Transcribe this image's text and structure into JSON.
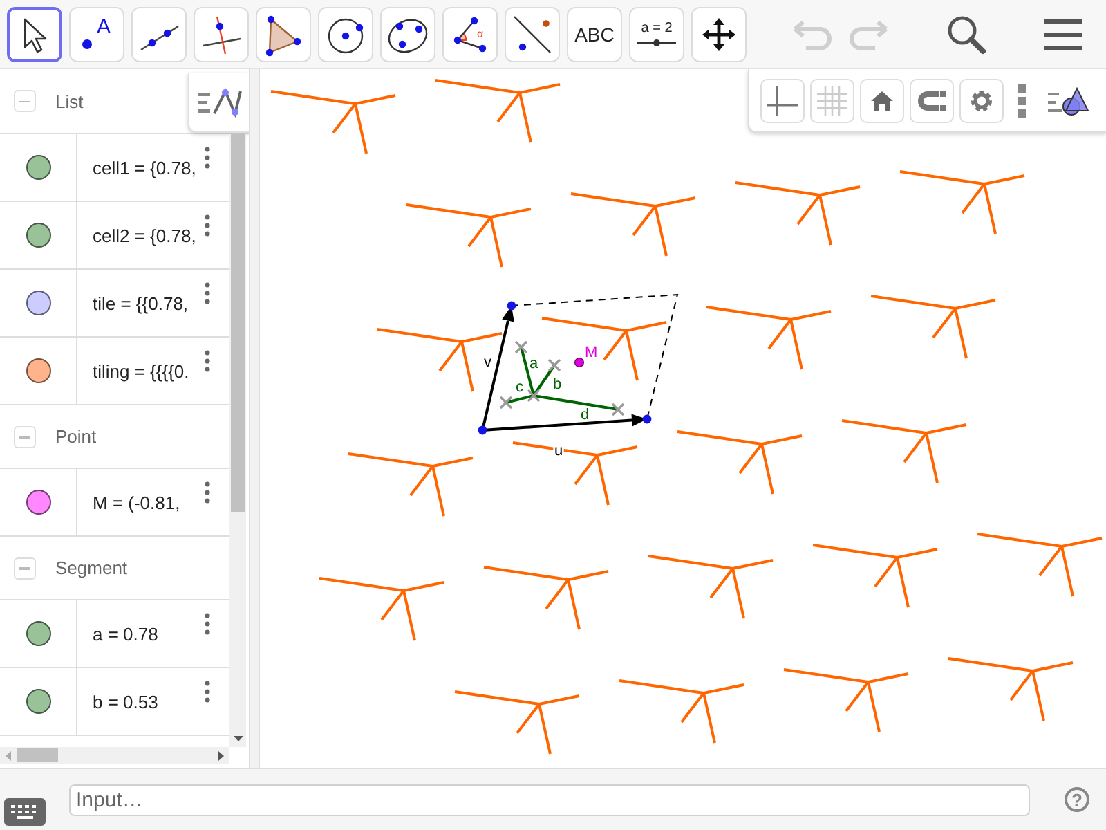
{
  "toolbar": {
    "tools": [
      {
        "kind": "move",
        "selected": true
      },
      {
        "kind": "point",
        "label": "A",
        "selected": false
      },
      {
        "kind": "line",
        "selected": false
      },
      {
        "kind": "perpendicular",
        "selected": false
      },
      {
        "kind": "polygon",
        "selected": false
      },
      {
        "kind": "circle",
        "selected": false
      },
      {
        "kind": "conic",
        "selected": false
      },
      {
        "kind": "angle",
        "label": "α",
        "selected": false
      },
      {
        "kind": "reflect",
        "selected": false
      },
      {
        "kind": "text",
        "label": "ABC",
        "selected": false
      },
      {
        "kind": "slider",
        "label": "a = 2",
        "selected": false
      },
      {
        "kind": "move-view",
        "selected": false
      }
    ],
    "undo": {
      "disabled": true
    },
    "redo": {
      "disabled": true
    }
  },
  "algebra": {
    "groups": [
      {
        "title": "List",
        "expanded": true,
        "items": [
          {
            "text": "cell1 = {0.78,",
            "color": "#99c299"
          },
          {
            "text": "cell2 = {0.78,",
            "color": "#99c299"
          },
          {
            "text": "tile = {{0.78,",
            "color": "#ccccff"
          },
          {
            "text": "tiling = {{{{0.",
            "color": "#ffb38a"
          }
        ]
      },
      {
        "title": "Point",
        "expanded": true,
        "items": [
          {
            "text": "M = (-0.81,",
            "color": "#ff88ff"
          }
        ]
      },
      {
        "title": "Segment",
        "expanded": true,
        "items": [
          {
            "text": "a = 0.78",
            "color": "#99c299"
          },
          {
            "text": "b = 0.53",
            "color": "#99c299"
          }
        ]
      }
    ]
  },
  "graphics": {
    "style_bar": [
      {
        "kind": "axes"
      },
      {
        "kind": "grid"
      },
      {
        "kind": "home"
      },
      {
        "kind": "magnet"
      },
      {
        "kind": "settings"
      },
      {
        "kind": "more"
      },
      {
        "kind": "view"
      }
    ],
    "labels": [
      {
        "text": "v",
        "kind": "vector"
      },
      {
        "text": "u",
        "kind": "vector"
      },
      {
        "text": "a",
        "kind": "segment"
      },
      {
        "text": "b",
        "kind": "segment"
      },
      {
        "text": "c",
        "kind": "segment"
      },
      {
        "text": "d",
        "kind": "segment"
      },
      {
        "text": "M",
        "kind": "point"
      }
    ]
  },
  "input_bar": {
    "placeholder": "Input…",
    "help": "?"
  }
}
